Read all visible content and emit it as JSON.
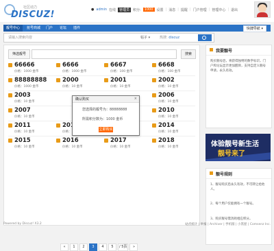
{
  "header": {
    "logo_text": "DISCUZ!",
    "logo_tag": "社区动力",
    "user": {
      "name": "admin",
      "status": "在线",
      "level": "管理员",
      "points_label": "积分:",
      "points": "1000",
      "links": [
        "设置",
        "消息",
        "提醒",
        "门户管理",
        "管理中心",
        "退出"
      ]
    }
  },
  "nav": {
    "items": [
      "靓号中心",
      "抢号商城",
      "门户",
      "论坛",
      "插件"
    ],
    "right_label": "快捷导航 ▾"
  },
  "search": {
    "placeholder": "请输入搜索内容",
    "type_label": "帖子 ▾",
    "hot_label": "热搜:",
    "hot_term": "discuz"
  },
  "panel": {
    "filter_label": "筛选靓号",
    "query_button": "搜索",
    "numbers": [
      {
        "num": "66666",
        "meta": "价格：1000 金币"
      },
      {
        "num": "6666",
        "meta": "价格：1000 金币"
      },
      {
        "num": "6667",
        "meta": "价格：100 金币"
      },
      {
        "num": "6668",
        "meta": "价格：100 金币"
      },
      {
        "num": "88888888",
        "meta": "价格：1000 金币"
      },
      {
        "num": "2000",
        "meta": "价格：10 金币"
      },
      {
        "num": "2001",
        "meta": "价格：10 金币"
      },
      {
        "num": "2002",
        "meta": "价格：10 金币"
      },
      {
        "num": "2003",
        "meta": "价格：10 金币"
      },
      {
        "num": "",
        "meta": ""
      },
      {
        "num": "",
        "meta": ""
      },
      {
        "num": "2006",
        "meta": "价格：10 金币"
      },
      {
        "num": "2007",
        "meta": "价格：10 金币"
      },
      {
        "num": "",
        "meta": ""
      },
      {
        "num": "",
        "meta": ""
      },
      {
        "num": "2010",
        "meta": "价格：10 金币"
      },
      {
        "num": "2011",
        "meta": "价格：10 金币"
      },
      {
        "num": "2012",
        "meta": "价格：10 金币"
      },
      {
        "num": "2013",
        "meta": "价格：10 金币"
      },
      {
        "num": "2014",
        "meta": "价格：10 金币"
      },
      {
        "num": "2015",
        "meta": "价格：10 金币"
      },
      {
        "num": "2016",
        "meta": "价格：10 金币"
      },
      {
        "num": "2017",
        "meta": "价格：10 金币"
      },
      {
        "num": "2018",
        "meta": "价格：10 金币"
      }
    ],
    "pagination": [
      "«",
      "1",
      "2",
      "3",
      "4",
      "5",
      "/ 5页",
      "»"
    ]
  },
  "modal": {
    "title": "确认购买",
    "close": "×",
    "line1": "您选择的靓号为：88888888",
    "line2": "所需积分数为：1000 金币",
    "confirm_button": "立即购买"
  },
  "sidebar": {
    "box1_title": "我要靓号",
    "box1_text": "购买靓号后，将获得独特的数字标识，门户和论坛显示更加醒目，支持自定义靓号申请，永久有效。",
    "banner_line1": "体验靓号新生活",
    "banner_line2": "靓号来了",
    "box2_title": "靓号规则",
    "box2_rules": [
      "1、靓号购买后永久有效，不可转让给他人。",
      "2、每个用户仅能拥有一个靓号。",
      "3、购买靓号需消耗相应积分。"
    ]
  },
  "footer": {
    "left": "Powered by Discuz! X3.2",
    "right": "站点统计 | 举报 | Archiver | 手机版 | 小黑屋 | Comsenz Inc."
  }
}
